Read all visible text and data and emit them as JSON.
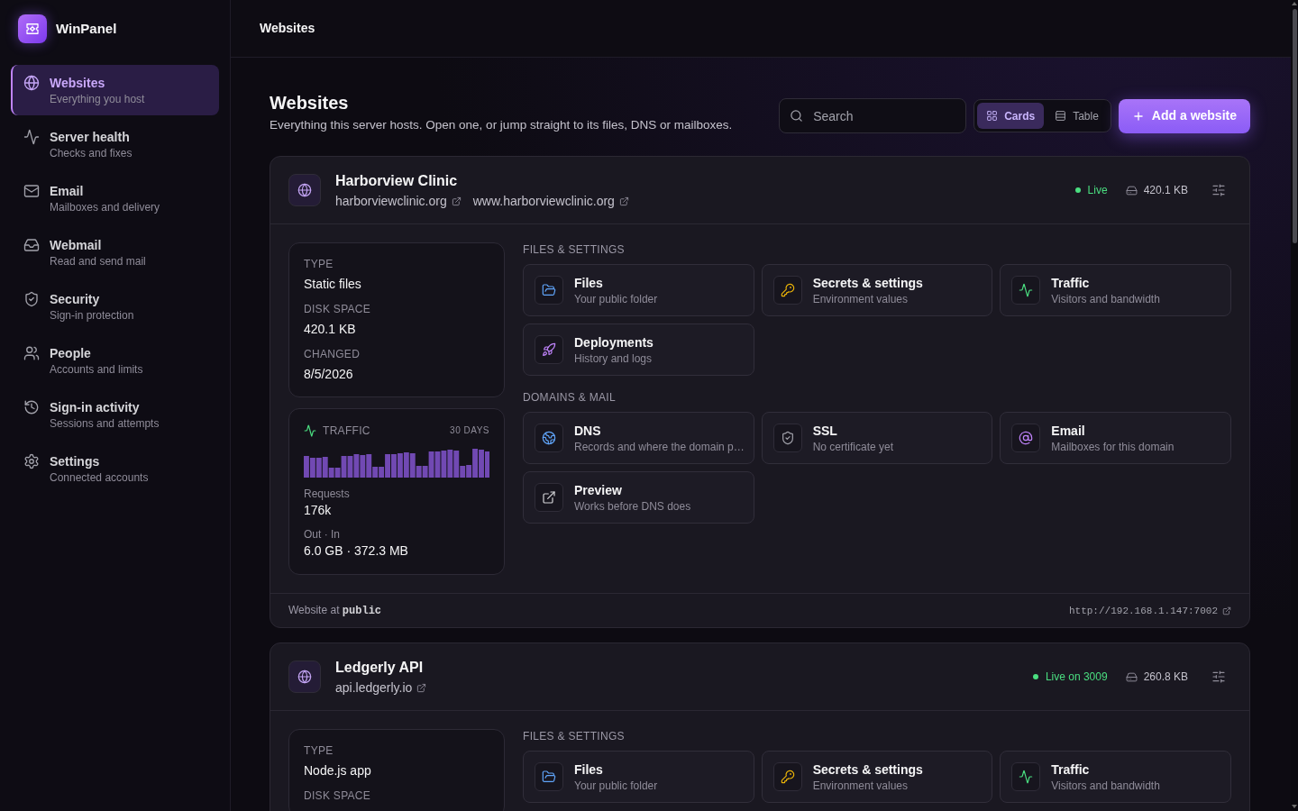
{
  "app": {
    "name": "WinPanel"
  },
  "sidebar": {
    "items": [
      {
        "title": "Websites",
        "subtitle": "Everything you host",
        "selected": true
      },
      {
        "title": "Server health",
        "subtitle": "Checks and fixes",
        "selected": false
      },
      {
        "title": "Email",
        "subtitle": "Mailboxes and delivery",
        "selected": false
      },
      {
        "title": "Webmail",
        "subtitle": "Read and send mail",
        "selected": false
      },
      {
        "title": "Security",
        "subtitle": "Sign-in protection",
        "selected": false
      },
      {
        "title": "People",
        "subtitle": "Accounts and limits",
        "selected": false
      },
      {
        "title": "Sign-in activity",
        "subtitle": "Sessions and attempts",
        "selected": false
      },
      {
        "title": "Settings",
        "subtitle": "Connected accounts",
        "selected": false
      }
    ]
  },
  "topbar": {
    "title": "Websites"
  },
  "page": {
    "title": "Websites",
    "subtitle": "Everything this server hosts. Open one, or jump straight to its files, DNS or mailboxes.",
    "search": {
      "placeholder": "Search"
    },
    "views": [
      {
        "label": "Cards",
        "selected": true
      },
      {
        "label": "Table",
        "selected": false
      }
    ],
    "add_button": "Add a website"
  },
  "sites": [
    {
      "name": "Harborview Clinic",
      "domains": [
        "harborviewclinic.org",
        "www.harborviewclinic.org"
      ],
      "status": "Live",
      "size": "420.1 KB",
      "details": [
        {
          "label": "TYPE",
          "value": "Static files"
        },
        {
          "label": "DISK SPACE",
          "value": "420.1 KB"
        },
        {
          "label": "CHANGED",
          "value": "8/5/2026"
        }
      ],
      "traffic": {
        "label": "TRAFFIC",
        "period": "30 DAYS",
        "stats": [
          {
            "label": "Requests",
            "value": "176k"
          },
          {
            "label": "Out · In",
            "value": "6.0 GB · 372.3 MB"
          }
        ]
      },
      "sections": [
        {
          "title": "FILES & SETTINGS",
          "tiles": [
            {
              "title": "Files",
              "subtitle": "Your public folder"
            },
            {
              "title": "Secrets & settings",
              "subtitle": "Environment values"
            },
            {
              "title": "Traffic",
              "subtitle": "Visitors and bandwidth"
            },
            {
              "title": "Deployments",
              "subtitle": "History and logs"
            }
          ]
        },
        {
          "title": "DOMAINS & MAIL",
          "tiles": [
            {
              "title": "DNS",
              "subtitle": "Records and where the domain p…"
            },
            {
              "title": "SSL",
              "subtitle": "No certificate yet"
            },
            {
              "title": "Email",
              "subtitle": "Mailboxes for this domain"
            },
            {
              "title": "Preview",
              "subtitle": "Works before DNS does"
            }
          ]
        }
      ],
      "footer": {
        "text": "Website at",
        "folder": "public",
        "url": "http://192.168.1.147:7002"
      }
    },
    {
      "name": "Ledgerly API",
      "domains": [
        "api.ledgerly.io"
      ],
      "status": "Live on 3009",
      "size": "260.8 KB",
      "details": [
        {
          "label": "TYPE",
          "value": "Node.js app"
        },
        {
          "label": "DISK SPACE"
        }
      ],
      "sections": [
        {
          "title": "FILES & SETTINGS",
          "tiles": [
            {
              "title": "Files",
              "subtitle": "Your public folder"
            },
            {
              "title": "Secrets & settings",
              "subtitle": "Environment values"
            },
            {
              "title": "Traffic",
              "subtitle": "Visitors and bandwidth"
            }
          ]
        }
      ]
    }
  ]
}
